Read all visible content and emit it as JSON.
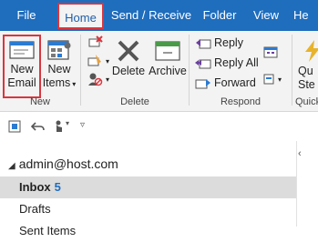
{
  "menubar": {
    "tabs": [
      {
        "label": "File"
      },
      {
        "label": "Home"
      },
      {
        "label": "Send / Receive"
      },
      {
        "label": "Folder"
      },
      {
        "label": "View"
      },
      {
        "label": "He"
      }
    ]
  },
  "ribbon": {
    "new_group": {
      "label": "New",
      "new_email_line1": "New",
      "new_email_line2": "Email",
      "new_items_line1": "New",
      "new_items_line2": "Items"
    },
    "delete_group": {
      "label": "Delete",
      "delete_label": "Delete",
      "archive_label": "Archive"
    },
    "respond_group": {
      "label": "Respond",
      "reply_label": "Reply",
      "reply_all_label": "Reply All",
      "forward_label": "Forward"
    },
    "quick_group": {
      "label": "Quick",
      "btn_line1": "Qu",
      "btn_line2": "Ste"
    }
  },
  "folder_pane": {
    "account": "admin@host.com",
    "folders": [
      {
        "name": "Inbox",
        "count": "5"
      },
      {
        "name": "Drafts"
      },
      {
        "name": "Sent Items"
      }
    ]
  },
  "colors": {
    "accent": "#1f6dbd",
    "highlight": "#d9363e"
  }
}
